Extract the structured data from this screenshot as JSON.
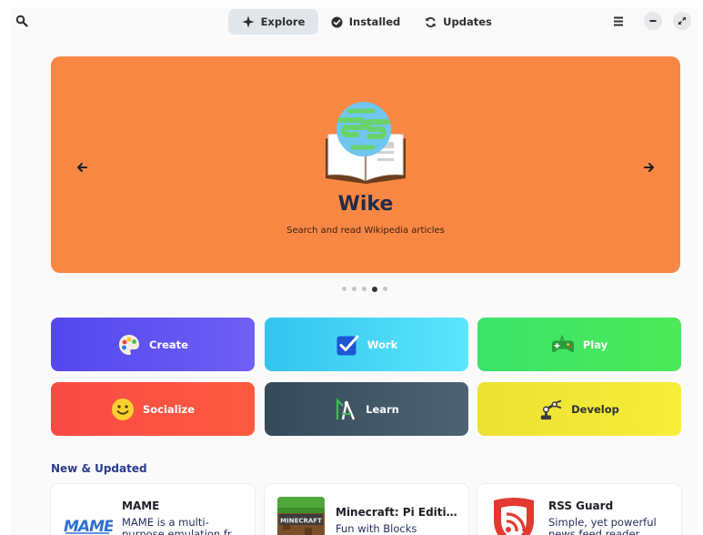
{
  "header": {
    "tabs": [
      {
        "label": "Explore",
        "icon": "sparkle-icon",
        "active": true
      },
      {
        "label": "Installed",
        "icon": "check-circle-icon",
        "active": false
      },
      {
        "label": "Updates",
        "icon": "refresh-icon",
        "active": false
      }
    ],
    "search_icon": "search-icon",
    "menu_icon": "hamburger-menu-icon",
    "minimize_icon": "minimize-icon",
    "restore_icon": "restore-icon"
  },
  "featured": {
    "title": "Wike",
    "description": "Search and read Wikipedia articles",
    "background": "#f98744",
    "page_count": 5,
    "current_page": 4
  },
  "categories": [
    {
      "label": "Create",
      "icon": "palette-icon",
      "color": "#5b4ff0"
    },
    {
      "label": "Work",
      "icon": "checkbox-icon",
      "color": "#3ed0f2"
    },
    {
      "label": "Play",
      "icon": "gamepad-icon",
      "color": "#41e865"
    },
    {
      "label": "Socialize",
      "icon": "smiley-icon",
      "color": "#fb4d44"
    },
    {
      "label": "Learn",
      "icon": "compass-icon",
      "color": "#3a4f5f"
    },
    {
      "label": "Develop",
      "icon": "robot-arm-icon",
      "color": "#f1e733"
    }
  ],
  "new_updated": {
    "title": "New & Updated",
    "apps": [
      {
        "name": "MAME",
        "summary": "MAME is a multi-purpose emulation fr",
        "logo": "mame-logo"
      },
      {
        "name": "Minecraft: Pi Edition:...",
        "summary": "Fun with Blocks",
        "logo": "minecraft-logo"
      },
      {
        "name": "RSS Guard",
        "summary": "Simple, yet powerful news feed reader",
        "logo": "rss-guard-logo"
      }
    ]
  }
}
